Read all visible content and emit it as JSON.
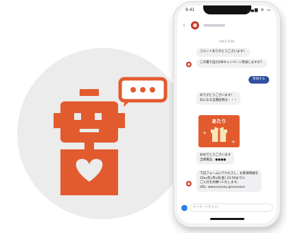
{
  "colors": {
    "brand": "#e25b2e",
    "accent": "#2f4f9f",
    "circle": "#ececec"
  },
  "illustration": {
    "robot_icon": "robot-with-heart-icon",
    "bubble_icon": "speech-bubble-ellipsis-icon"
  },
  "phone": {
    "status": {
      "time": "9:41",
      "icons": "▂▄▆ ≋ ▭"
    },
    "header": {
      "back_icon": "‹"
    },
    "date_label": "UNCE 0000",
    "messages": {
      "m1": "コメントありがとうございます！",
      "m2": "この電で出たDMキャンペーン参加しますか？",
      "reply": "参加する",
      "m3_line1": "ありがとうございます！",
      "m3_line2": "気になる当選結果は・・・",
      "prize": "あたり",
      "m4_line1": "おめでとうございます",
      "m4_line2": "当選賞品：●●●●",
      "m5_line1": "下記フォームにアクセスし、お客様情報を",
      "m5_line2": "20xx年x月x日(金) 23:59までに",
      "m5_line3": "ご入力をお願いいたします。",
      "m5_line4": "URL: www.xxxxxx.jp/xxxxxxx"
    },
    "composer_placeholder": "メッセージを入力..."
  }
}
